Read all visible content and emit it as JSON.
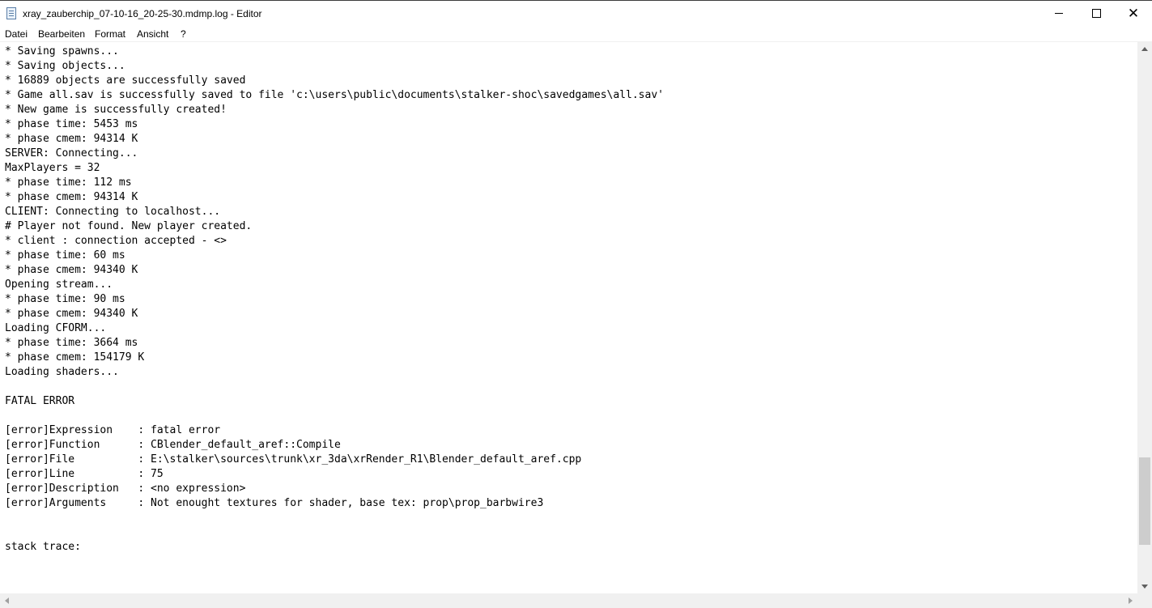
{
  "window": {
    "title": "xray_zauberchip_07-10-16_20-25-30.mdmp.log - Editor",
    "icon": "notepad-icon",
    "controls": {
      "minimize": "minimize-icon",
      "maximize": "maximize-icon",
      "close": "✕"
    }
  },
  "menu": {
    "items": [
      {
        "label": "Datei"
      },
      {
        "label": "Bearbeiten"
      },
      {
        "label": "Format"
      },
      {
        "label": "Ansicht"
      },
      {
        "label": "?"
      }
    ]
  },
  "editor": {
    "lines": [
      "* Saving spawns...",
      "* Saving objects...",
      "* 16889 objects are successfully saved",
      "* Game all.sav is successfully saved to file 'c:\\users\\public\\documents\\stalker-shoc\\savedgames\\all.sav'",
      "* New game is successfully created!",
      "* phase time: 5453 ms",
      "* phase cmem: 94314 K",
      "SERVER: Connecting...",
      "MaxPlayers = 32",
      "* phase time: 112 ms",
      "* phase cmem: 94314 K",
      "CLIENT: Connecting to localhost...",
      "# Player not found. New player created.",
      "* client : connection accepted - <>",
      "* phase time: 60 ms",
      "* phase cmem: 94340 K",
      "Opening stream...",
      "* phase time: 90 ms",
      "* phase cmem: 94340 K",
      "Loading CFORM...",
      "* phase time: 3664 ms",
      "* phase cmem: 154179 K",
      "Loading shaders...",
      "",
      "FATAL ERROR",
      "",
      "[error]Expression    : fatal error",
      "[error]Function      : CBlender_default_aref::Compile",
      "[error]File          : E:\\stalker\\sources\\trunk\\xr_3da\\xrRender_R1\\Blender_default_aref.cpp",
      "[error]Line          : 75",
      "[error]Description   : <no expression>",
      "[error]Arguments     : Not enought textures for shader, base tex: prop\\prop_barbwire3",
      "",
      "",
      "stack trace:"
    ]
  },
  "scrollbar": {
    "vertical_position": 0.92
  }
}
